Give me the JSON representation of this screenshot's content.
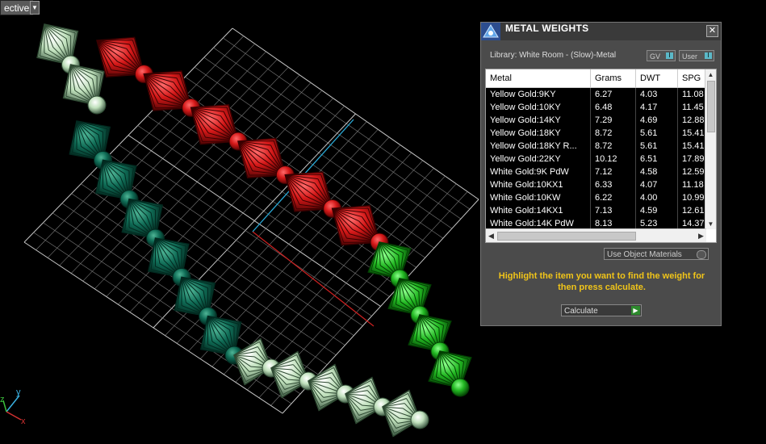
{
  "viewport": {
    "label": "ective",
    "dropdown_icon": "triangle-down-icon",
    "axis_labels": {
      "x": "x",
      "y": "y",
      "z": "z"
    },
    "colors": {
      "grid": "#9a9a9a",
      "red_band": "#d21414",
      "green_band": "#1fb21f",
      "teal_band": "#0f6b55",
      "pale_band": "#b9dcb6",
      "x_axis": "#c82020",
      "y_axis": "#2aa9d6"
    }
  },
  "panel": {
    "title": "METAL WEIGHTS",
    "logo_icon": "triangle-logo-icon",
    "close_icon": "close-icon",
    "library": "Library: White Room - (Slow)-Metal",
    "toggle_gv": "GV",
    "toggle_user": "User",
    "columns": [
      "Metal",
      "Grams",
      "DWT",
      "SPG"
    ],
    "rows": [
      [
        "Yellow Gold:9KY",
        "6.27",
        "4.03",
        "11.08"
      ],
      [
        "Yellow Gold:10KY",
        "6.48",
        "4.17",
        "11.45"
      ],
      [
        "Yellow Gold:14KY",
        "7.29",
        "4.69",
        "12.88"
      ],
      [
        "Yellow Gold:18KY",
        "8.72",
        "5.61",
        "15.41"
      ],
      [
        "Yellow Gold:18KY R...",
        "8.72",
        "5.61",
        "15.41"
      ],
      [
        "Yellow Gold:22KY",
        "10.12",
        "6.51",
        "17.89"
      ],
      [
        "White Gold:9K PdW",
        "7.12",
        "4.58",
        "12.59"
      ],
      [
        "White Gold:10KX1",
        "6.33",
        "4.07",
        "11.18"
      ],
      [
        "White Gold:10KW",
        "6.22",
        "4.00",
        "10.99"
      ],
      [
        "White Gold:14KX1",
        "7.13",
        "4.59",
        "12.61"
      ],
      [
        "White Gold:14K PdW",
        "8.13",
        "5.23",
        "14.37"
      ]
    ],
    "use_object_materials": "Use Object Materials",
    "hint": "Highlight the item you want to find the weight for then press calculate.",
    "calculate": "Calculate",
    "colors": {
      "hint": "#f0c419",
      "play": "#2d8a2d"
    }
  }
}
